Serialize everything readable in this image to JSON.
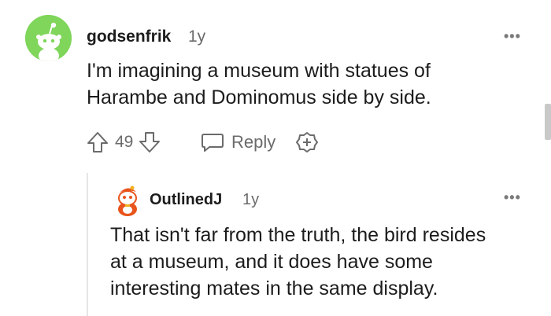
{
  "comments": [
    {
      "author": "godsenfrik",
      "age": "1y",
      "more": "•••",
      "lines": [
        "I'm imagining a museum with statues of",
        "Harambe and Dominomus side by side."
      ],
      "votes": "49",
      "reply_label": "Reply"
    },
    {
      "author": "OutlinedJ",
      "age": "1y",
      "more": "•••",
      "lines": [
        "That isn't far from the truth, the bird resides",
        "at a museum, and it does have some",
        "interesting mates in the same display."
      ]
    }
  ],
  "colors": {
    "avatar_bg": "#7fd65a",
    "text": "#1c1c1c",
    "muted": "#6b6b6b"
  },
  "icons": [
    "snoo-avatar-icon",
    "upvote-icon",
    "downvote-icon",
    "comment-bubble-icon",
    "award-plus-icon",
    "more-options-icon"
  ]
}
